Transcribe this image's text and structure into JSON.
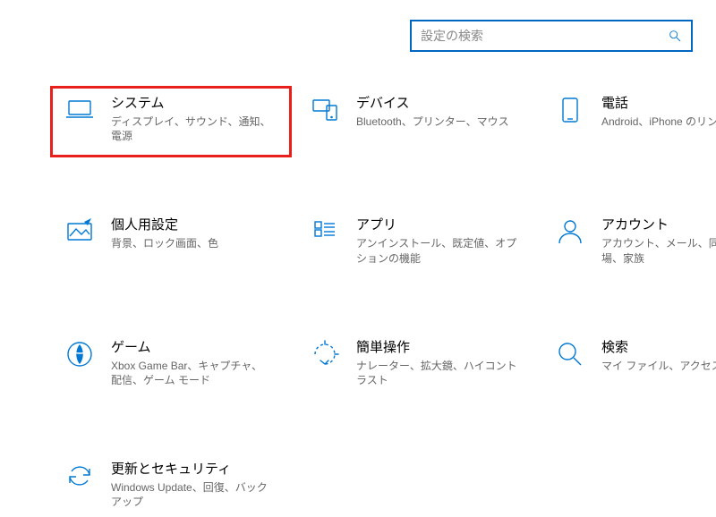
{
  "search": {
    "placeholder": "設定の検索"
  },
  "items": [
    {
      "title": "システム",
      "subtitle": "ディスプレイ、サウンド、通知、電源"
    },
    {
      "title": "デバイス",
      "subtitle": "Bluetooth、プリンター、マウス"
    },
    {
      "title": "電話",
      "subtitle": "Android、iPhone のリンク"
    },
    {
      "title": "個人用設定",
      "subtitle": "背景、ロック画面、色"
    },
    {
      "title": "アプリ",
      "subtitle": "アンインストール、既定値、オプションの機能"
    },
    {
      "title": "アカウント",
      "subtitle": "アカウント、メール、同期、職場、家族"
    },
    {
      "title": "ゲーム",
      "subtitle": "Xbox Game Bar、キャプチャ、配信、ゲーム モード"
    },
    {
      "title": "簡単操作",
      "subtitle": "ナレーター、拡大鏡、ハイコントラスト"
    },
    {
      "title": "検索",
      "subtitle": "マイ ファイル、アクセス許可"
    },
    {
      "title": "更新とセキュリティ",
      "subtitle": "Windows Update、回復、バックアップ"
    }
  ]
}
